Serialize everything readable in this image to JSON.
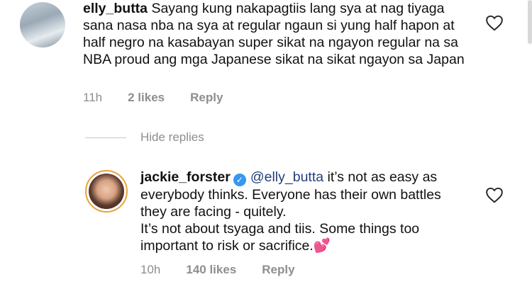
{
  "comments": [
    {
      "username": "elly_butta",
      "text": "Sayang kung nakapagtiis lang sya at nag tiyaga sana nasa nba na sya at regular ngaun si yung half hapon at half negro na kasabayan super sikat na ngayon regular na sa NBA proud ang mga Japanese sikat na sikat ngayon sa Japan",
      "time": "11h",
      "likes": "2 likes",
      "reply_label": "Reply"
    },
    {
      "username": "jackie_forster",
      "verified_glyph": "✓",
      "mention": "@elly_butta",
      "text": " it’s not as easy as everybody thinks. Everyone has their own battles they are facing - quitely.",
      "text2": "It’s not about tsyaga and tiis. Some things too important to risk or sacrifice.",
      "emoji": "💕",
      "time": "10h",
      "likes": "140 likes",
      "reply_label": "Reply"
    }
  ],
  "hide_replies_label": "Hide replies",
  "colors": {
    "meta": "#8e8e8e",
    "mention": "#233f7a",
    "verified": "#3897f0"
  },
  "icons": {
    "like": "heart-outline-icon"
  }
}
